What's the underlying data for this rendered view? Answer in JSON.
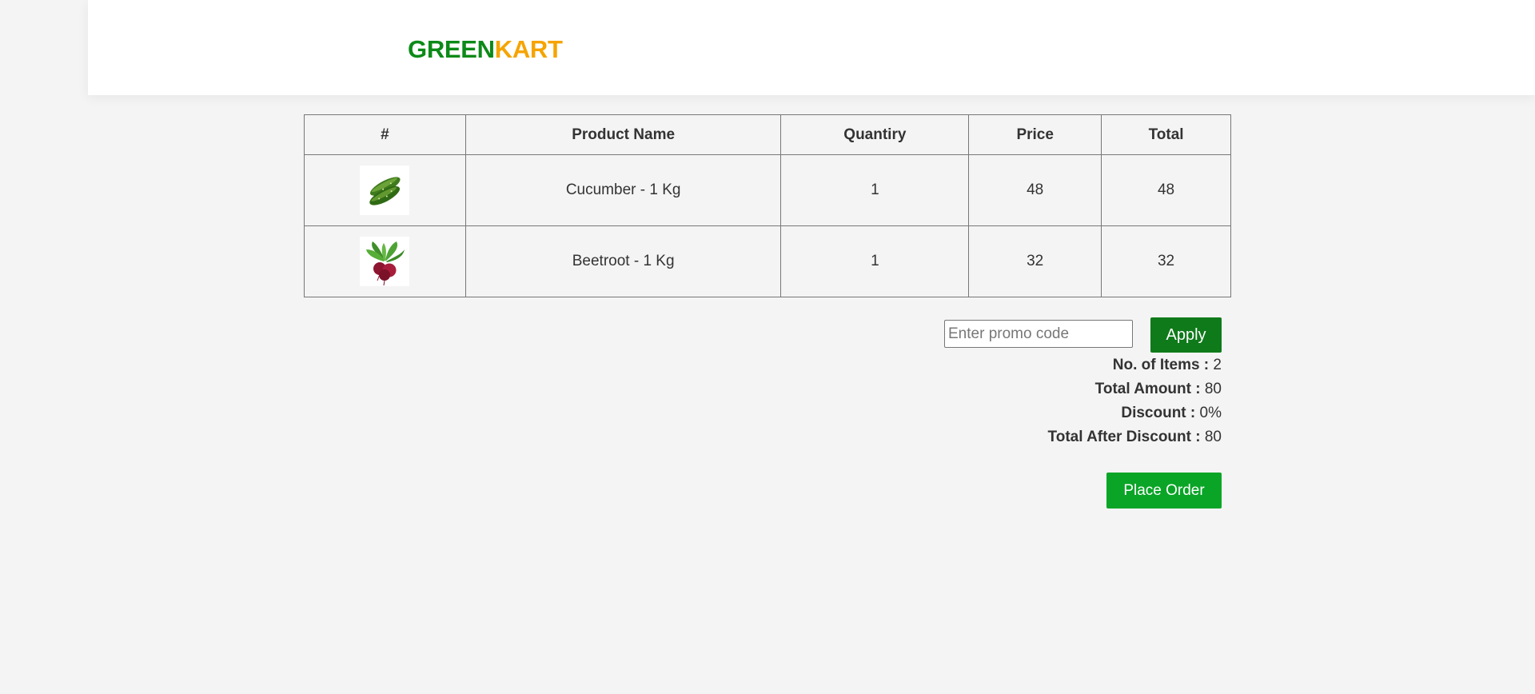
{
  "header": {
    "brand_green": "GREEN",
    "brand_kart": "KART"
  },
  "table": {
    "columns": [
      "#",
      "Product Name",
      "Quantiry",
      "Price",
      "Total"
    ],
    "rows": [
      {
        "image": "cucumber-image",
        "name": "Cucumber - 1 Kg",
        "quantity": "1",
        "price": "48",
        "total": "48"
      },
      {
        "image": "beetroot-image",
        "name": "Beetroot - 1 Kg",
        "quantity": "1",
        "price": "32",
        "total": "32"
      }
    ]
  },
  "promo": {
    "placeholder": "Enter promo code",
    "value": "",
    "apply_label": "Apply"
  },
  "summary": {
    "items_label": "No. of Items :",
    "items_value": "2",
    "amount_label": "Total Amount :",
    "amount_value": "80",
    "discount_label": "Discount :",
    "discount_value": "0%",
    "after_label": "Total After Discount :",
    "after_value": "80"
  },
  "place_order_label": "Place Order",
  "colors": {
    "brand_green": "#0c8a18",
    "brand_orange": "#f5a400",
    "apply_button": "#0f7a1a",
    "place_order_button": "#0aa527"
  }
}
